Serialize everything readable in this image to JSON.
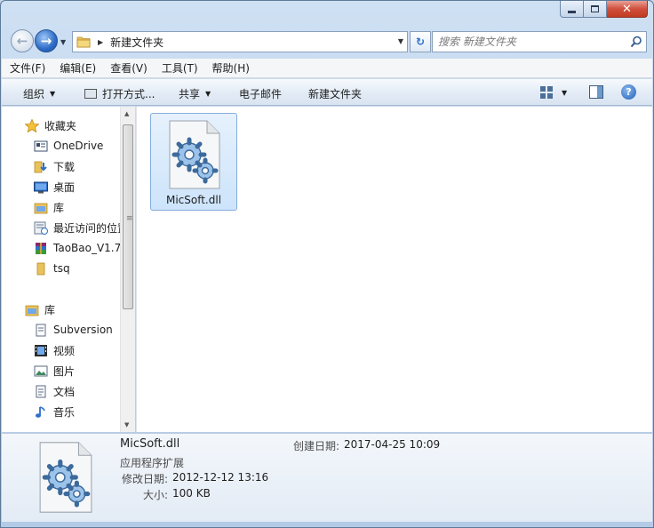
{
  "window": {
    "close_glyph": "✕"
  },
  "address_bar": {
    "path": "新建文件夹",
    "refresh_glyph": "↻"
  },
  "search": {
    "placeholder": "搜索 新建文件夹"
  },
  "menu": [
    "文件(F)",
    "编辑(E)",
    "查看(V)",
    "工具(T)",
    "帮助(H)"
  ],
  "toolbar": {
    "organize": "组织",
    "open_with": "打开方式...",
    "share": "共享",
    "email": "电子邮件",
    "new_folder": "新建文件夹",
    "help_glyph": "?"
  },
  "nav_pane": {
    "favorites": {
      "label": "收藏夹",
      "items": [
        "OneDrive",
        "下载",
        "桌面",
        "库",
        "最近访问的位置",
        "TaoBao_V1.7",
        "tsq"
      ]
    },
    "libraries": {
      "label": "库",
      "items": [
        "Subversion",
        "视频",
        "图片",
        "文档",
        "音乐"
      ]
    }
  },
  "files": [
    {
      "name": "MicSoft.dll",
      "icon": "dll-gear-icon",
      "selected": true
    }
  ],
  "details": {
    "name": "MicSoft.dll",
    "type": "应用程序扩展",
    "modified_label": "修改日期:",
    "modified_value": "2012-12-12 13:16",
    "size_label": "大小:",
    "size_value": "100 KB",
    "created_label": "创建日期:",
    "created_value": "2017-04-25 10:09"
  },
  "colors": {
    "accent": "#2c6bc7",
    "selection": "#cde4fb",
    "close_button": "#c23a22"
  }
}
